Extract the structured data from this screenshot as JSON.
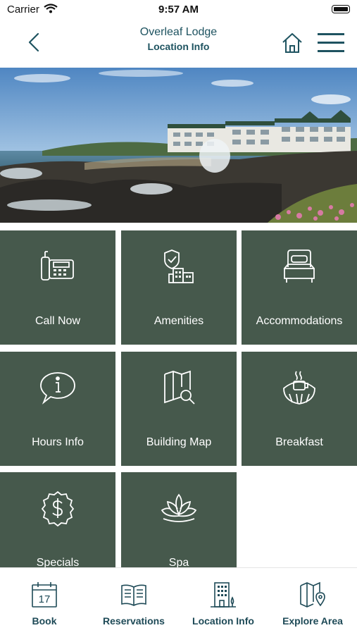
{
  "status_bar": {
    "carrier": "Carrier",
    "time": "9:57 AM"
  },
  "header": {
    "title": "Overleaf Lodge",
    "subtitle": "Location Info"
  },
  "tiles": [
    {
      "label": "Call Now",
      "icon": "phone-icon"
    },
    {
      "label": "Amenities",
      "icon": "shield-building-icon"
    },
    {
      "label": "Accommodations",
      "icon": "bed-icon"
    },
    {
      "label": "Hours Info",
      "icon": "info-bubble-icon"
    },
    {
      "label": "Building Map",
      "icon": "map-search-icon"
    },
    {
      "label": "Breakfast",
      "icon": "coffee-croissant-icon"
    },
    {
      "label": "Specials",
      "icon": "dollar-badge-icon"
    },
    {
      "label": "Spa",
      "icon": "lotus-icon"
    }
  ],
  "tabs": [
    {
      "label": "Book",
      "icon": "calendar-icon",
      "calendar_day": "17"
    },
    {
      "label": "Reservations",
      "icon": "book-icon"
    },
    {
      "label": "Location Info",
      "icon": "building-icon"
    },
    {
      "label": "Explore Area",
      "icon": "map-pin-icon"
    }
  ],
  "colors": {
    "tile": "#46594c",
    "accent": "#1e5360",
    "tab_text": "#1e4a57"
  }
}
